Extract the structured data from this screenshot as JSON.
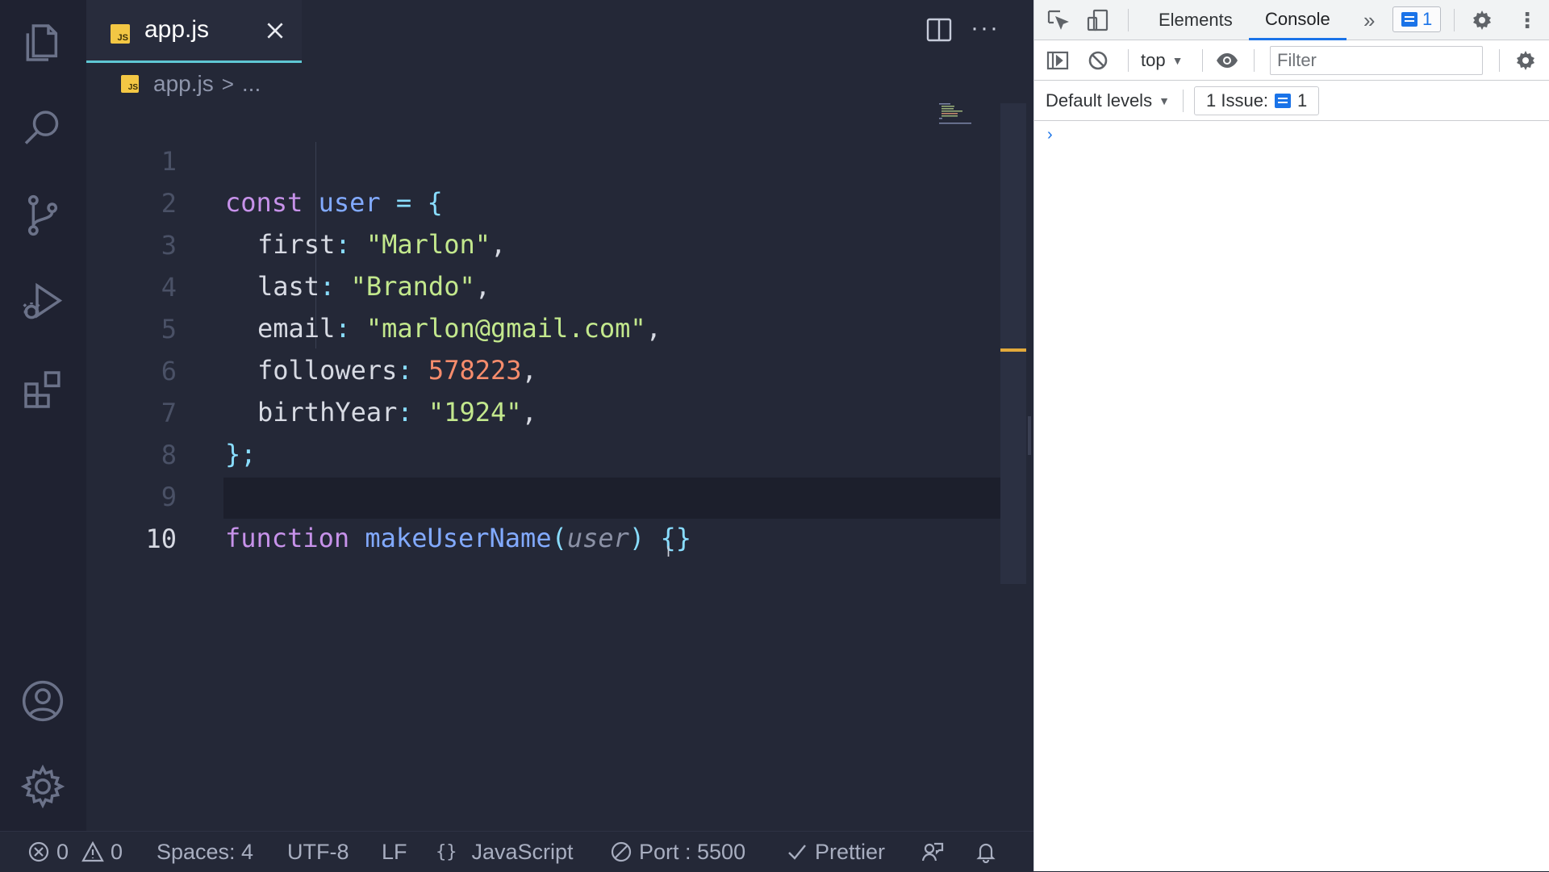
{
  "editor": {
    "tab": {
      "title": "app.js",
      "badge": "JS"
    },
    "breadcrumb": {
      "file": "app.js",
      "separator": ">",
      "rest": "..."
    },
    "lines": [
      {
        "num": "1"
      },
      {
        "num": "2"
      },
      {
        "num": "3"
      },
      {
        "num": "4"
      },
      {
        "num": "5"
      },
      {
        "num": "6"
      },
      {
        "num": "7"
      },
      {
        "num": "8"
      },
      {
        "num": "9"
      },
      {
        "num": "10"
      }
    ],
    "tokens": {
      "l1": {
        "kw": "const",
        "name": "user",
        "op": "=",
        "brace": "{"
      },
      "l2": {
        "key": "first",
        "colon": ":",
        "value": "\"Marlon\"",
        "comma": ","
      },
      "l3": {
        "key": "last",
        "colon": ":",
        "value": "\"Brando\"",
        "comma": ","
      },
      "l4": {
        "key": "email",
        "colon": ":",
        "value": "\"marlon@gmail.com\"",
        "comma": ","
      },
      "l5": {
        "key": "followers",
        "colon": ":",
        "value": "578223",
        "comma": ","
      },
      "l6": {
        "key": "birthYear",
        "colon": ":",
        "value": "\"1924\"",
        "comma": ","
      },
      "l7": {
        "close": "};"
      },
      "l9": {
        "kw": "function",
        "name": "makeUserName",
        "open": "(",
        "param": "user",
        "close": ")",
        "body": "{}"
      }
    }
  },
  "statusbar": {
    "errors": "0",
    "warnings": "0",
    "spaces": "Spaces: 4",
    "encoding": "UTF-8",
    "eol": "LF",
    "language_brackets": "{}",
    "language": "JavaScript",
    "port": "Port : 5500",
    "prettier": "Prettier"
  },
  "devtools": {
    "tabs": {
      "elements": "Elements",
      "console": "Console"
    },
    "more_tabs": "»",
    "issues_badge_count": "1",
    "context": "top",
    "dropdown_arrow": "▼",
    "filter_placeholder": "Filter",
    "levels": "Default levels",
    "issues_label": "1 Issue:",
    "issues_count": "1",
    "prompt": "›"
  },
  "colors": {
    "accent_tab": "#5fc7d4",
    "js_badge": "#f3c744",
    "devtools_active": "#1a73e8",
    "scroll_marker": "#e2a93b"
  }
}
